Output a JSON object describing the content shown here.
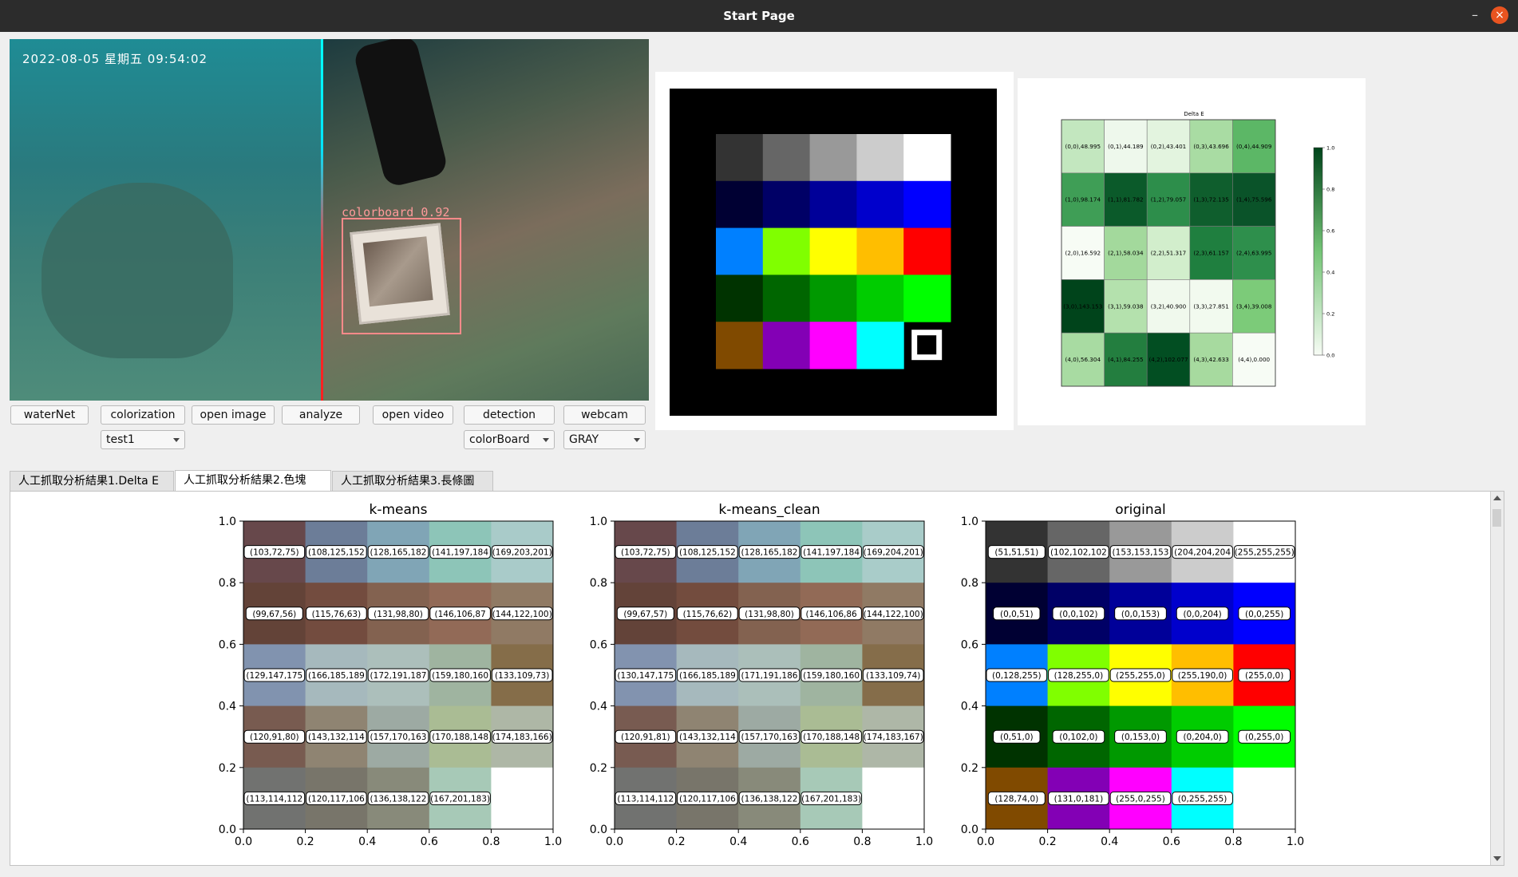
{
  "window": {
    "title": "Start Page",
    "minimize": "–",
    "close": "×"
  },
  "camera": {
    "timestamp": "2022-08-05   星期五   09:54:02",
    "detection_label": "colorboard 0.92"
  },
  "buttons": {
    "waternet": "waterNet",
    "colorization": "colorization",
    "open_image": "open image",
    "analyze": "analyze",
    "open_video": "open video",
    "detection": "detection",
    "webcam": "webcam"
  },
  "combos": {
    "test": "test1",
    "model": "colorBoard",
    "mode": "GRAY"
  },
  "tabs": [
    "人工抓取分析結果1.Delta E",
    "人工抓取分析結果2.色塊",
    "人工抓取分析結果3.長條圖"
  ],
  "colorboard": {
    "rows": [
      [
        "#333333",
        "#666666",
        "#999999",
        "#cccccc",
        "#ffffff"
      ],
      [
        "#000033",
        "#000066",
        "#000099",
        "#0000cc",
        "#0000ff"
      ],
      [
        "#0080ff",
        "#80ff00",
        "#ffff00",
        "#ffbe00",
        "#ff0000"
      ],
      [
        "#003300",
        "#006600",
        "#009900",
        "#00cc00",
        "#00ff00"
      ],
      [
        "#804a00",
        "#8300b5",
        "#ff00ff",
        "#00ffff",
        "marker"
      ]
    ]
  },
  "delta_e": {
    "title": "Delta E",
    "cells": [
      [
        "(0,0),48.995",
        "(0,1),44.189",
        "(0,2),43.401",
        "(0,3),43.696",
        "(0,4),44.909"
      ],
      [
        "(1,0),98.174",
        "(1,1),81.782",
        "(1,2),79.057",
        "(1,3),72.135",
        "(1,4),75.596"
      ],
      [
        "(2,0),16.592",
        "(2,1),58.034",
        "(2,2),51.317",
        "(2,3),61.157",
        "(2,4),63.995"
      ],
      [
        "(3,0),143.153",
        "(3,1),59.038",
        "(3,2),40.900",
        "(3,3),27.851",
        "(3,4),39.008"
      ],
      [
        "(4,0),56.304",
        "(4,1),84.255",
        "(4,2),102.077",
        "(4,3),42.633",
        "(4,4),0.000"
      ]
    ],
    "colors": [
      [
        "#c3e7bf",
        "#eef8ec",
        "#e3f4df",
        "#a9dca3",
        "#5cb766"
      ],
      [
        "#3f9e56",
        "#0b5a2a",
        "#2d8e4b",
        "#0f5e2d",
        "#0a5329"
      ],
      [
        "#f7fcf5",
        "#a3d99c",
        "#d2eecc",
        "#1f7f3f",
        "#2e8f4c"
      ],
      [
        "#00441b",
        "#b4e1ad",
        "#f0f9ed",
        "#f2faef",
        "#7ccb79"
      ],
      [
        "#a8dba2",
        "#237e3f",
        "#024e22",
        "#a7da9f",
        "#f7fcf5"
      ]
    ],
    "colorbar_ticks": [
      "1.0",
      "0.8",
      "0.6",
      "0.4",
      "0.2",
      "0.0"
    ]
  },
  "chart_data": [
    {
      "type": "heatmap",
      "title": "k-means",
      "xticks": [
        "0.0",
        "0.2",
        "0.4",
        "0.6",
        "0.8",
        "1.0"
      ],
      "yticks": [
        "1.0",
        "0.8",
        "0.6",
        "0.4",
        "0.2",
        "0.0"
      ],
      "rows": [
        {
          "labels": [
            "(103,72,75)",
            "(108,125,152",
            "(128,165,182",
            "(141,197,184",
            "(169,203,201)"
          ],
          "top": [
            "#67484b",
            "#6c7d98",
            "#80a5b6",
            "#8dc5b8",
            "#a9cbc9"
          ],
          "bottom": [
            "#67484b",
            "#6c7d98",
            "#80a5b6",
            "#8dc5b8",
            "#a9cbc9"
          ]
        },
        {
          "labels": [
            "(99,67,56)",
            "(115,76,63)",
            "(131,98,80)",
            "(146,106,87",
            "(144,122,100)"
          ],
          "top": [
            "#634338",
            "#734c3f",
            "#836250",
            "#926a57",
            "#907a64"
          ],
          "bottom": [
            "#634338",
            "#734c3f",
            "#836250",
            "#926a57",
            "#907a64"
          ]
        },
        {
          "labels": [
            "(129,147,175",
            "(166,185,189",
            "(172,191,187",
            "(159,180,160",
            "(133,109,73)"
          ],
          "top": [
            "#8193af",
            "#a6b9bd",
            "#acbfbb",
            "#9fb4a0",
            "#856d49"
          ],
          "bottom": [
            "#8193af",
            "#a6b9bd",
            "#acbfbb",
            "#9fb4a0",
            "#856d49"
          ]
        },
        {
          "labels": [
            "(120,91,80)",
            "(143,132,114",
            "(157,170,163",
            "(170,188,148",
            "(174,183,166)"
          ],
          "top": [
            "#785b50",
            "#8f8472",
            "#9daaa3",
            "#aabc94",
            "#aeb7a6"
          ],
          "bottom": [
            "#785b50",
            "#8f8472",
            "#9daaa3",
            "#aabc94",
            "#aeb7a6"
          ]
        },
        {
          "labels": [
            "(113,114,112",
            "(120,117,106",
            "(136,138,122",
            "(167,201,183)",
            ""
          ],
          "top": [
            "#717270",
            "#78756a",
            "#888a7a",
            "#a7c9b7",
            "#ffffff"
          ],
          "bottom": [
            "#717270",
            "#78756a",
            "#888a7a",
            "#a7c9b7",
            "#ffffff"
          ]
        }
      ]
    },
    {
      "type": "heatmap",
      "title": "k-means_clean",
      "xticks": [
        "0.0",
        "0.2",
        "0.4",
        "0.6",
        "0.8",
        "1.0"
      ],
      "yticks": [
        "1.0",
        "0.8",
        "0.6",
        "0.4",
        "0.2",
        "0.0"
      ],
      "rows": [
        {
          "labels": [
            "(103,72,75)",
            "(108,125,152",
            "(128,165,182",
            "(141,197,184",
            "(169,204,201)"
          ],
          "top": [
            "#67484b",
            "#6c7d98",
            "#80a5b6",
            "#8dc5b8",
            "#a9ccc9"
          ],
          "bottom": [
            "#67484b",
            "#6c7d98",
            "#80a5b6",
            "#8dc5b8",
            "#a9ccc9"
          ]
        },
        {
          "labels": [
            "(99,67,57)",
            "(115,76,62)",
            "(131,98,80)",
            "(146,106,86",
            "(144,122,100)"
          ],
          "top": [
            "#634339",
            "#734c3e",
            "#836250",
            "#926a56",
            "#907a64"
          ],
          "bottom": [
            "#634339",
            "#734c3e",
            "#836250",
            "#926a56",
            "#907a64"
          ]
        },
        {
          "labels": [
            "(130,147,175",
            "(166,185,189",
            "(171,191,186",
            "(159,180,160",
            "(133,109,74)"
          ],
          "top": [
            "#8293af",
            "#a6b9bd",
            "#abbfba",
            "#9fb4a0",
            "#856d4a"
          ],
          "bottom": [
            "#8293af",
            "#a6b9bd",
            "#abbfba",
            "#9fb4a0",
            "#856d4a"
          ]
        },
        {
          "labels": [
            "(120,91,81)",
            "(143,132,114",
            "(157,170,163",
            "(170,188,148",
            "(174,183,167)"
          ],
          "top": [
            "#785b51",
            "#8f8472",
            "#9daaa3",
            "#aabc94",
            "#aeb7a7"
          ],
          "bottom": [
            "#785b51",
            "#8f8472",
            "#9daaa3",
            "#aabc94",
            "#aeb7a7"
          ]
        },
        {
          "labels": [
            "(113,114,112",
            "(120,117,106",
            "(136,138,122",
            "(167,201,183)",
            ""
          ],
          "top": [
            "#717270",
            "#78756a",
            "#888a7a",
            "#a7c9b7",
            "#ffffff"
          ],
          "bottom": [
            "#717270",
            "#78756a",
            "#888a7a",
            "#a7c9b7",
            "#ffffff"
          ]
        }
      ]
    },
    {
      "type": "heatmap",
      "title": "original",
      "xticks": [
        "0.0",
        "0.2",
        "0.4",
        "0.6",
        "0.8",
        "1.0"
      ],
      "yticks": [
        "1.0",
        "0.8",
        "0.6",
        "0.4",
        "0.2",
        "0.0"
      ],
      "rows": [
        {
          "labels": [
            "(51,51,51)",
            "(102,102,102",
            "(153,153,153",
            "(204,204,204",
            "(255,255,255)"
          ],
          "top": [
            "#333333",
            "#666666",
            "#999999",
            "#cccccc",
            "#ffffff"
          ],
          "bottom": [
            "#333333",
            "#666666",
            "#999999",
            "#cccccc",
            "#ffffff"
          ]
        },
        {
          "labels": [
            "(0,0,51)",
            "(0,0,102)",
            "(0,0,153)",
            "(0,0,204)",
            "(0,0,255)"
          ],
          "top": [
            "#000033",
            "#000066",
            "#000099",
            "#0000cc",
            "#0000ff"
          ],
          "bottom": [
            "#000033",
            "#000066",
            "#000099",
            "#0000cc",
            "#0000ff"
          ]
        },
        {
          "labels": [
            "(0,128,255)",
            "(128,255,0)",
            "(255,255,0)",
            "(255,190,0)",
            "(255,0,0)"
          ],
          "top": [
            "#0080ff",
            "#80ff00",
            "#ffff00",
            "#ffbe00",
            "#ff0000"
          ],
          "bottom": [
            "#0080ff",
            "#80ff00",
            "#ffff00",
            "#ffbe00",
            "#ff0000"
          ]
        },
        {
          "labels": [
            "(0,51,0)",
            "(0,102,0)",
            "(0,153,0)",
            "(0,204,0)",
            "(0,255,0)"
          ],
          "top": [
            "#003300",
            "#006600",
            "#009900",
            "#00cc00",
            "#00ff00"
          ],
          "bottom": [
            "#003300",
            "#006600",
            "#009900",
            "#00cc00",
            "#00ff00"
          ]
        },
        {
          "labels": [
            "(128,74,0)",
            "(131,0,181)",
            "(255,0,255)",
            "(0,255,255)",
            ""
          ],
          "top": [
            "#804a00",
            "#8300b5",
            "#ff00ff",
            "#00ffff",
            "#ffffff"
          ],
          "bottom": [
            "#804a00",
            "#8300b5",
            "#ff00ff",
            "#00ffff",
            "#ffffff"
          ]
        }
      ]
    }
  ]
}
